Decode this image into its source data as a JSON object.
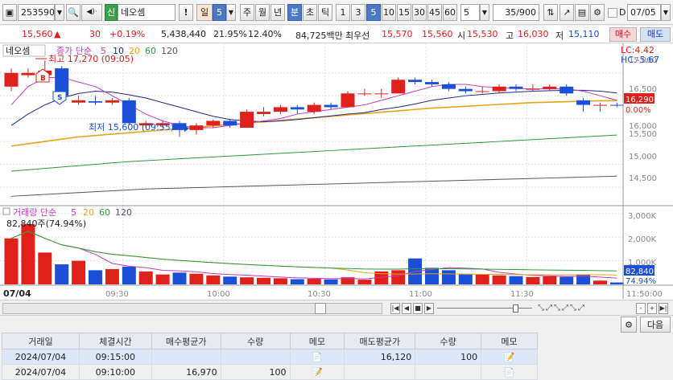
{
  "toolbar": {
    "code": "253590",
    "market_badge": "신",
    "stock_name": "네오셈",
    "warn": "!",
    "period_day": "일",
    "period_num": "5",
    "periods": [
      "주",
      "월",
      "년",
      "분",
      "초",
      "틱"
    ],
    "minutes": [
      "1",
      "3",
      "5",
      "10",
      "15",
      "30",
      "45",
      "60"
    ],
    "selected_minute": "5",
    "count_value": "5",
    "page": "35/900",
    "date_check_label": "D",
    "date": "07/05"
  },
  "quote": {
    "price": "15,560",
    "change_arrow": "▲",
    "change": "30",
    "change_pct": "+0.19%",
    "volume": "5,438,440",
    "pct1": "21.95%",
    "pct2": "12.40%",
    "amount": "84,725백만",
    "ask_label": "최우선",
    "ask": "15,570",
    "bid": "15,560",
    "open_label": "시",
    "open": "15,530",
    "high_label": "고",
    "high": "16,030",
    "low_label": "저",
    "low": "15,110",
    "buy_button": "매수",
    "sell_button": "매도"
  },
  "chart_legend": {
    "name": "네오셈",
    "price_label": "종가 단순",
    "ma": [
      "5",
      "10",
      "20",
      "60",
      "120"
    ],
    "high_note": "최고 17,270 (09:05)",
    "low_note": "최저 15,600 (09:55)",
    "lc": "LC:4.42",
    "hc": "HC:-5.67",
    "price_tag": "16,290",
    "pct_tag": "0.00%",
    "marker_s": "S",
    "marker_b": "B",
    "vol_label": "거래량 단순",
    "vol_ma": [
      "5",
      "20",
      "60",
      "120"
    ],
    "vol_note": "82,840주(74.94%)",
    "vol_tag": "82,840",
    "vol_pct_tag": "74.94%",
    "day_label": "07/04"
  },
  "colors": {
    "up": "#e0201b",
    "down": "#1c4fd8",
    "ma5": "#c43ac4",
    "ma10": "#1a2a8c",
    "ma20": "#e8a317",
    "ma60": "#2a9a3a",
    "ma120": "#555566"
  },
  "chart_data": {
    "type": "candlestick",
    "price_axis": [
      "17,000",
      "16,500",
      "16,000",
      "15,500",
      "15,000",
      "14,500"
    ],
    "volume_axis": [
      "3,000K",
      "2,000K",
      "1,000K"
    ],
    "time_axis": [
      "09:30",
      "10:00",
      "10:30",
      "11:00",
      "11:30",
      "11:50:00"
    ],
    "ylim": [
      14200,
      17400
    ],
    "candles": [
      {
        "o": 16700,
        "c": 17000,
        "h": 17100,
        "l": 16600
      },
      {
        "o": 16950,
        "c": 17000,
        "h": 17100,
        "l": 16900
      },
      {
        "o": 16950,
        "c": 17050,
        "h": 17270,
        "l": 16900
      },
      {
        "o": 17100,
        "c": 16500,
        "h": 17150,
        "l": 16400
      },
      {
        "o": 16350,
        "c": 16400,
        "h": 16500,
        "l": 16300
      },
      {
        "o": 16380,
        "c": 16350,
        "h": 16500,
        "l": 16300
      },
      {
        "o": 16350,
        "c": 16400,
        "h": 16450,
        "l": 16300
      },
      {
        "o": 16400,
        "c": 15900,
        "h": 16450,
        "l": 15850
      },
      {
        "o": 15850,
        "c": 15900,
        "h": 15950,
        "l": 15800
      },
      {
        "o": 15850,
        "c": 15900,
        "h": 15950,
        "l": 15800
      },
      {
        "o": 15900,
        "c": 15750,
        "h": 15950,
        "l": 15600
      },
      {
        "o": 15750,
        "c": 15850,
        "h": 15900,
        "l": 15650
      },
      {
        "o": 15850,
        "c": 15950,
        "h": 15980,
        "l": 15800
      },
      {
        "o": 15950,
        "c": 15850,
        "h": 15980,
        "l": 15800
      },
      {
        "o": 15800,
        "c": 16150,
        "h": 16200,
        "l": 15800
      },
      {
        "o": 16100,
        "c": 16150,
        "h": 16250,
        "l": 16050
      },
      {
        "o": 16150,
        "c": 16250,
        "h": 16300,
        "l": 16100
      },
      {
        "o": 16250,
        "c": 16200,
        "h": 16300,
        "l": 16100
      },
      {
        "o": 16150,
        "c": 16300,
        "h": 16350,
        "l": 16100
      },
      {
        "o": 16300,
        "c": 16250,
        "h": 16350,
        "l": 16200
      },
      {
        "o": 16250,
        "c": 16550,
        "h": 16600,
        "l": 16250
      },
      {
        "o": 16550,
        "c": 16550,
        "h": 16650,
        "l": 16500
      },
      {
        "o": 16550,
        "c": 16550,
        "h": 16650,
        "l": 16450
      },
      {
        "o": 16550,
        "c": 16850,
        "h": 16900,
        "l": 16550
      },
      {
        "o": 16850,
        "c": 16800,
        "h": 16900,
        "l": 16750
      },
      {
        "o": 16800,
        "c": 16750,
        "h": 16850,
        "l": 16700
      },
      {
        "o": 16750,
        "c": 16650,
        "h": 16800,
        "l": 16600
      },
      {
        "o": 16650,
        "c": 16600,
        "h": 16700,
        "l": 16550
      },
      {
        "o": 16600,
        "c": 16600,
        "h": 16700,
        "l": 16550
      },
      {
        "o": 16600,
        "c": 16700,
        "h": 16750,
        "l": 16550
      },
      {
        "o": 16700,
        "c": 16650,
        "h": 16750,
        "l": 16600
      },
      {
        "o": 16650,
        "c": 16650,
        "h": 16750,
        "l": 16600
      },
      {
        "o": 16650,
        "c": 16700,
        "h": 16750,
        "l": 16600
      },
      {
        "o": 16700,
        "c": 16550,
        "h": 16750,
        "l": 16500
      },
      {
        "o": 16400,
        "c": 16300,
        "h": 16450,
        "l": 16150
      },
      {
        "o": 16300,
        "c": 16300,
        "h": 16350,
        "l": 16150
      },
      {
        "o": 16300,
        "c": 16290,
        "h": 16350,
        "l": 16250
      }
    ],
    "volumes": [
      1950,
      2550,
      1350,
      850,
      1000,
      600,
      650,
      750,
      550,
      420,
      500,
      450,
      380,
      330,
      300,
      280,
      260,
      220,
      240,
      210,
      300,
      200,
      550,
      600,
      1100,
      700,
      600,
      450,
      420,
      380,
      350,
      310,
      340,
      320,
      420,
      160,
      83
    ],
    "ma5": [
      16300,
      16700,
      16900,
      16900,
      16800,
      16700,
      16500,
      16300,
      16100,
      15950,
      15850,
      15800,
      15800,
      15850,
      15900,
      15950,
      16000,
      16100,
      16150,
      16200,
      16250,
      16300,
      16400,
      16500,
      16600,
      16700,
      16750,
      16750,
      16700,
      16680,
      16660,
      16650,
      16650,
      16650,
      16600,
      16500,
      16400
    ],
    "ma10": [
      15850,
      16100,
      16300,
      16450,
      16550,
      16600,
      16580,
      16520,
      16450,
      16350,
      16250,
      16150,
      16050,
      15980,
      15950,
      15930,
      15950,
      15980,
      16020,
      16060,
      16100,
      16130,
      16200,
      16250,
      16320,
      16400,
      16450,
      16500,
      16530,
      16560,
      16580,
      16600,
      16610,
      16620,
      16620,
      16600,
      16560
    ],
    "ma20": [
      15400,
      15450,
      15500,
      15550,
      15600,
      15630,
      15660,
      15690,
      15720,
      15750,
      15780,
      15810,
      15840,
      15870,
      15900,
      15930,
      15960,
      15990,
      16020,
      16050,
      16080,
      16110,
      16140,
      16170,
      16200,
      16230,
      16250,
      16270,
      16290,
      16310,
      16330,
      16350,
      16360,
      16370,
      16380,
      16390,
      16390
    ],
    "ma60": [
      14850,
      14880,
      14910,
      14940,
      14970,
      15000,
      15030,
      15060,
      15080,
      15100,
      15120,
      15140,
      15160,
      15180,
      15200,
      15220,
      15240,
      15260,
      15280,
      15300,
      15320,
      15340,
      15360,
      15380,
      15400,
      15420,
      15440,
      15460,
      15480,
      15500,
      15520,
      15540,
      15560,
      15580,
      15600,
      15620,
      15640
    ],
    "ma120": [
      14300,
      14320,
      14340,
      14360,
      14380,
      14400,
      14420,
      14440,
      14460,
      14470,
      14480,
      14490,
      14500,
      14510,
      14520,
      14530,
      14540,
      14550,
      14560,
      14570,
      14580,
      14590,
      14600,
      14610,
      14620,
      14630,
      14640,
      14650,
      14660,
      14670,
      14680,
      14690,
      14700,
      14710,
      14720,
      14730,
      14740
    ]
  },
  "scroll": {
    "zoom_minus": "-",
    "zoom_plus": "+"
  },
  "grid": {
    "next_button": "다음",
    "columns": [
      "거래일",
      "체결시간",
      "매수평균가",
      "수량",
      "메모",
      "매도평균가",
      "수량",
      "메모"
    ],
    "rows": [
      {
        "date": "2024/07/04",
        "time": "09:15:00",
        "buy_avg": "",
        "buy_qty": "",
        "sell_avg": "16,120",
        "sell_qty": "100"
      },
      {
        "date": "2024/07/04",
        "time": "09:10:00",
        "buy_avg": "16,970",
        "buy_qty": "100",
        "sell_avg": "",
        "sell_qty": ""
      }
    ]
  }
}
